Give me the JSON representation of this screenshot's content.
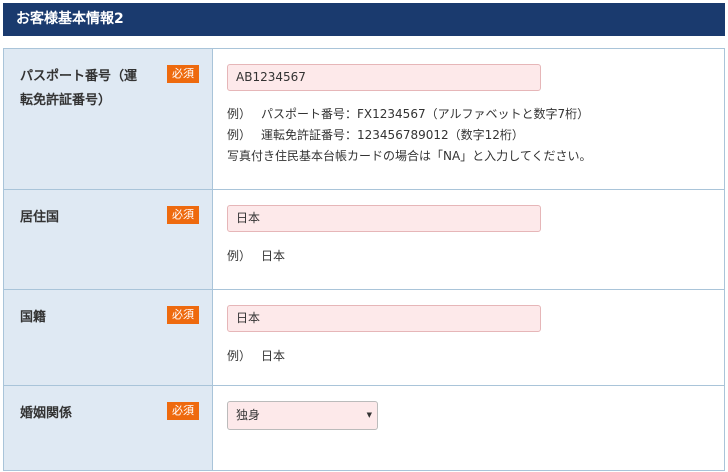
{
  "section": {
    "title": "お客様基本情報2"
  },
  "required_label": "必須",
  "fields": {
    "passport": {
      "label": "パスポート番号（運転免許証番号）",
      "value": "AB1234567",
      "examples": [
        {
          "prefix": "例）",
          "text": "パスポート番号：FX1234567（アルファベットと数字7桁）"
        },
        {
          "prefix": "例）",
          "text": "運転免許証番号：123456789012（数字12桁）"
        }
      ],
      "note": "写真付き住民基本台帳カードの場合は「NA」と入力してください。"
    },
    "residence": {
      "label": "居住国",
      "value": "日本",
      "example_prefix": "例）",
      "example_text": "日本"
    },
    "nationality": {
      "label": "国籍",
      "value": "日本",
      "example_prefix": "例）",
      "example_text": "日本"
    },
    "marital": {
      "label": "婚姻関係",
      "selected": "独身",
      "arrow_icon": "dropdown-arrow-icon"
    }
  },
  "colors": {
    "header_bg": "#1a3a6e",
    "label_bg": "#dfe9f3",
    "badge_bg": "#ee6a0e",
    "input_bg": "#fde9ea",
    "border": "#a9c4d9"
  }
}
